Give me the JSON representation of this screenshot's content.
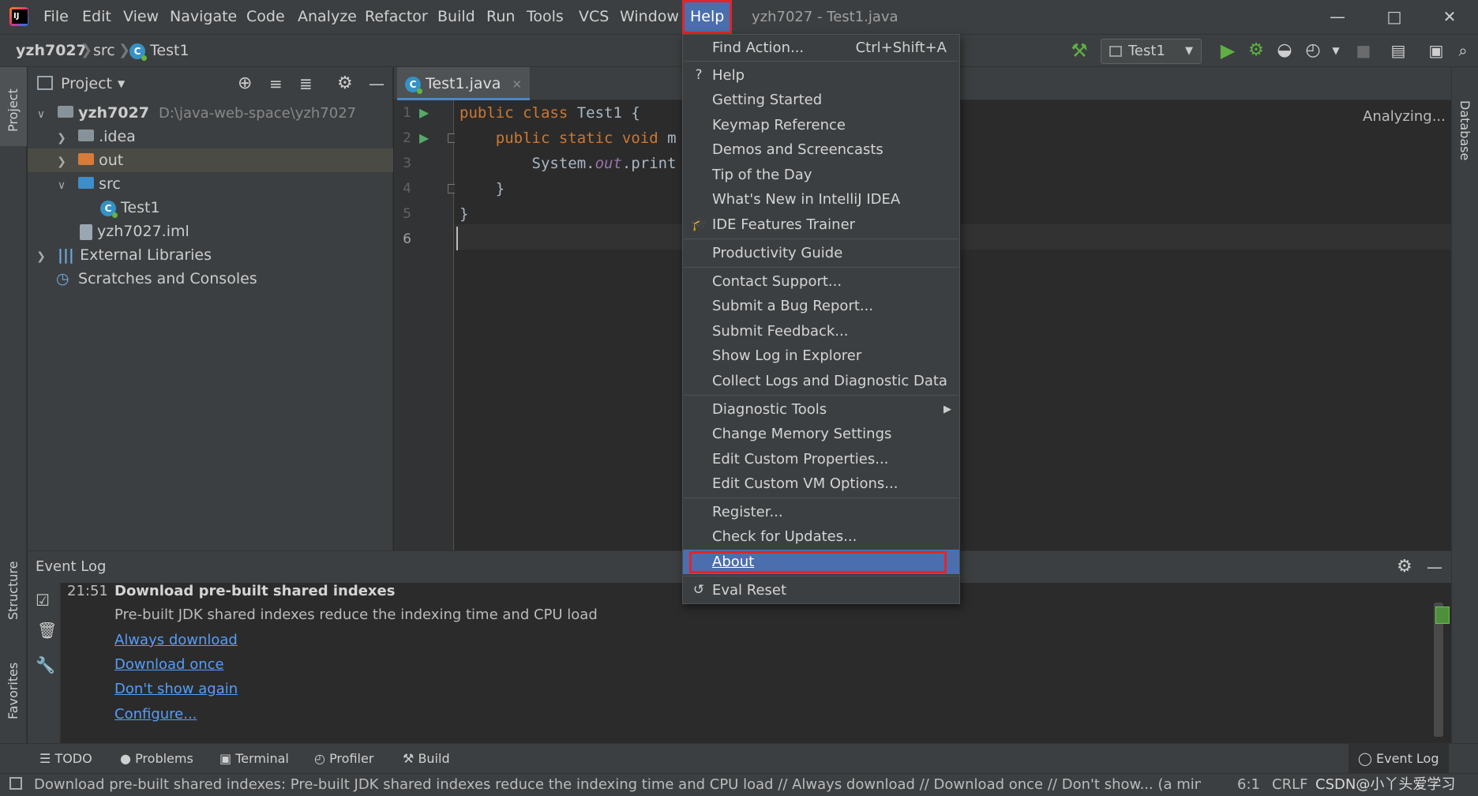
{
  "app": {
    "window_title": "yzh7027 - Test1.java"
  },
  "menu": [
    "File",
    "Edit",
    "View",
    "Navigate",
    "Code",
    "Analyze",
    "Refactor",
    "Build",
    "Run",
    "Tools",
    "VCS",
    "Window",
    "Help"
  ],
  "breadcrumb": {
    "project": "yzh7027",
    "folder": "src",
    "file": "Test1"
  },
  "run_config": "Test1",
  "left_strip": {
    "project": "Project",
    "structure": "Structure",
    "favorites": "Favorites"
  },
  "right_strip": {
    "database": "Database"
  },
  "project_panel": {
    "title": "Project",
    "tree": [
      {
        "label": "yzh7027",
        "extra": "D:\\java-web-space\\yzh7027",
        "level": 0,
        "expanded": true
      },
      {
        "label": ".idea",
        "level": 1,
        "expanded": false
      },
      {
        "label": "out",
        "level": 1,
        "expanded": false,
        "selected": true
      },
      {
        "label": "src",
        "level": 1,
        "expanded": true
      },
      {
        "label": "Test1",
        "level": 2
      },
      {
        "label": "yzh7027.iml",
        "level": 1
      },
      {
        "label": "External Libraries",
        "level": 0,
        "expanded": false
      },
      {
        "label": "Scratches and Consoles",
        "level": 0
      }
    ]
  },
  "editor": {
    "tab": "Test1.java",
    "line_numbers": [
      "1",
      "2",
      "3",
      "4",
      "5",
      "6"
    ],
    "code": {
      "l1_kw": "public class ",
      "l1_rest": "Test1 {",
      "l2_kw": "    public static void ",
      "l2_rest": "m",
      "l3_a": "        System.",
      "l3_b": "out",
      "l3_c": ".print",
      "l4": "    }",
      "l5": "}"
    },
    "status": "Analyzing..."
  },
  "help_menu": {
    "find_action": {
      "label": "Find Action...",
      "shortcut": "Ctrl+Shift+A"
    },
    "items": {
      "help": "Help",
      "getting_started": "Getting Started",
      "keymap": "Keymap Reference",
      "demos": "Demos and Screencasts",
      "tip": "Tip of the Day",
      "whats_new": "What's New in IntelliJ IDEA",
      "features_trainer": "IDE Features Trainer",
      "productivity": "Productivity Guide",
      "contact": "Contact Support...",
      "bug": "Submit a Bug Report...",
      "feedback": "Submit Feedback...",
      "show_log": "Show Log in Explorer",
      "collect_logs": "Collect Logs and Diagnostic Data",
      "diag_tools": "Diagnostic Tools",
      "memory": "Change Memory Settings",
      "custom_props": "Edit Custom Properties...",
      "custom_vm": "Edit Custom VM Options...",
      "register": "Register...",
      "updates": "Check for Updates...",
      "about": "About",
      "eval_reset": "Eval Reset"
    }
  },
  "event_log": {
    "title": "Event Log",
    "time": "21:51",
    "heading": "Download pre-built shared indexes",
    "message": "Pre-built JDK shared indexes reduce the indexing time and CPU load",
    "links": [
      "Always download",
      "Download once",
      "Don't show again",
      "Configure..."
    ]
  },
  "bottom_tabs": [
    "TODO",
    "Problems",
    "Terminal",
    "Profiler",
    "Build"
  ],
  "event_log_tab": "Event Log",
  "status_bar": {
    "message": "Download pre-built shared indexes: Pre-built JDK shared indexes reduce the indexing time and CPU load // Always download // Download once // Don't show... (a minute a",
    "position": "6:1",
    "line_sep": "CRLF",
    "watermark": "CSDN@小丫头爱学习"
  }
}
